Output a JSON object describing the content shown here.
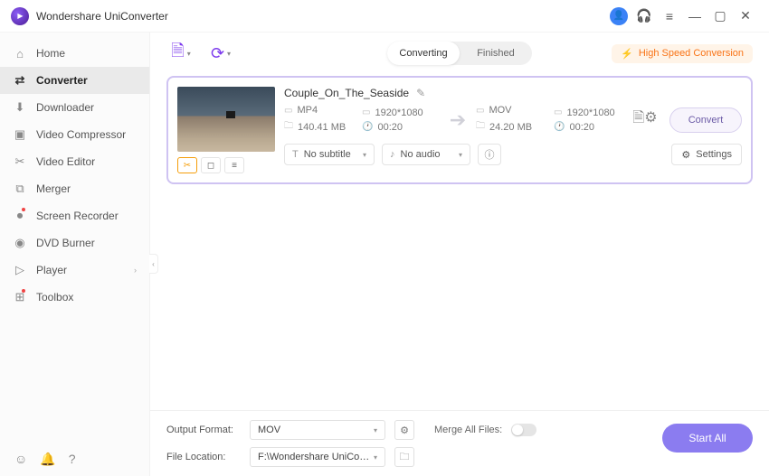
{
  "app": {
    "title": "Wondershare UniConverter"
  },
  "titlebar": {
    "user_icon": "user-icon",
    "headset_icon": "headset-icon",
    "menu_icon": "menu-icon",
    "min_icon": "minimize-icon",
    "max_icon": "maximize-icon",
    "close_icon": "close-icon"
  },
  "sidebar": {
    "items": [
      {
        "label": "Home",
        "icon": "⌂"
      },
      {
        "label": "Converter",
        "icon": "⇄",
        "selected": true
      },
      {
        "label": "Downloader",
        "icon": "⬇"
      },
      {
        "label": "Video Compressor",
        "icon": "▣"
      },
      {
        "label": "Video Editor",
        "icon": "✂"
      },
      {
        "label": "Merger",
        "icon": "⧉"
      },
      {
        "label": "Screen Recorder",
        "icon": "⏺",
        "dot": true
      },
      {
        "label": "DVD Burner",
        "icon": "◉"
      },
      {
        "label": "Player",
        "icon": "▷"
      },
      {
        "label": "Toolbox",
        "icon": "⊞",
        "dot": true
      }
    ],
    "footer_icons": [
      "feedback-icon",
      "bell-icon",
      "help-icon"
    ]
  },
  "tabs": {
    "converting": "Converting",
    "finished": "Finished"
  },
  "highspeed": {
    "label": "High Speed Conversion"
  },
  "file": {
    "name": "Couple_On_The_Seaside",
    "src": {
      "format": "MP4",
      "resolution": "1920*1080",
      "size": "140.41 MB",
      "duration": "00:20"
    },
    "dst": {
      "format": "MOV",
      "resolution": "1920*1080",
      "size": "24.20 MB",
      "duration": "00:20"
    },
    "convert_label": "Convert",
    "subtitle_label": "No subtitle",
    "audio_label": "No audio",
    "settings_label": "Settings"
  },
  "footer": {
    "output_format_label": "Output Format:",
    "output_format_value": "MOV",
    "file_location_label": "File Location:",
    "file_location_value": "F:\\Wondershare UniConverter",
    "merge_label": "Merge All Files:",
    "start_all": "Start All"
  }
}
